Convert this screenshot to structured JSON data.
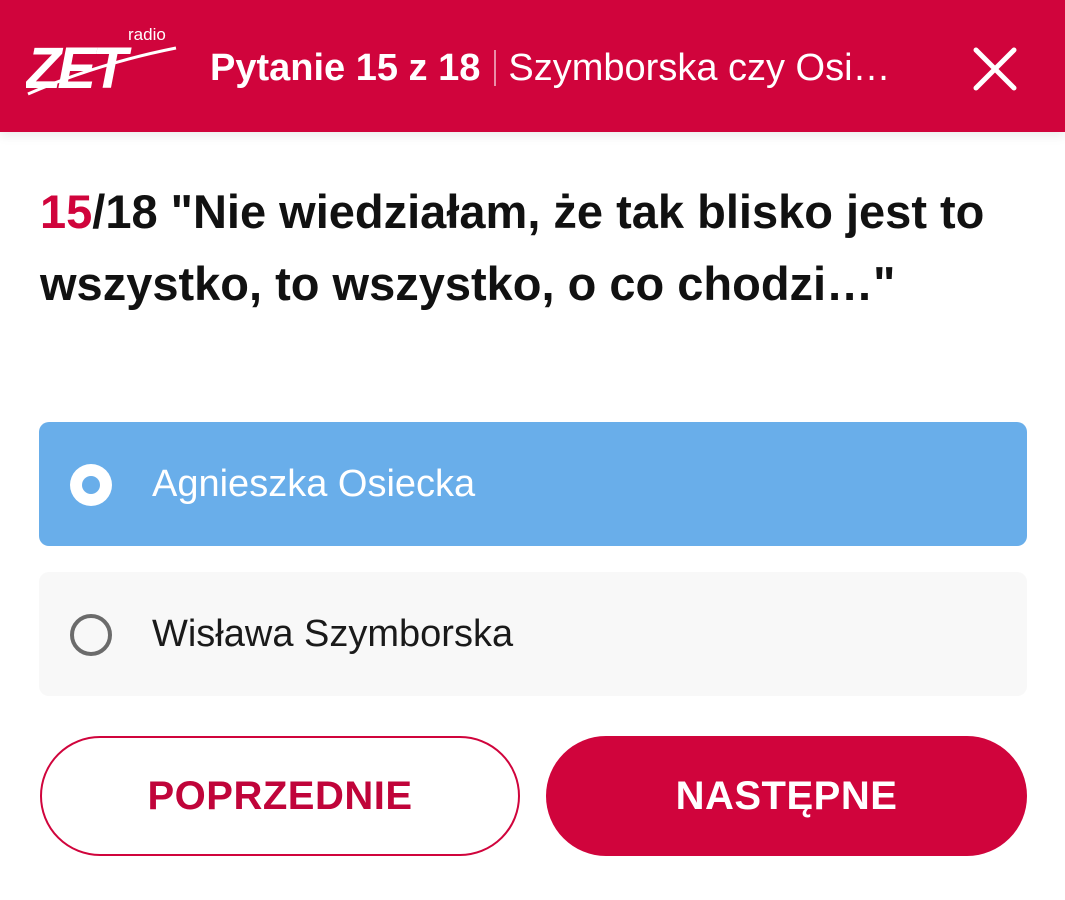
{
  "header": {
    "logo_text": "ZET",
    "logo_small": "radio",
    "question_counter": "Pytanie 15 z 18",
    "quiz_title": "Szymborska czy Osi…",
    "close_icon": "close-icon",
    "brand_color": "#d0043c"
  },
  "question": {
    "number": "15",
    "total": "/18",
    "text": " \"Nie wiedziałam, że tak blisko jest to wszystko, to wszystko, o co chodzi…\""
  },
  "options": [
    {
      "label": "Agnieszka Osiecka",
      "selected": true,
      "color": "#69aeea"
    },
    {
      "label": "Wisława Szymborska",
      "selected": false
    }
  ],
  "buttons": {
    "prev_label": "POPRZEDNIE",
    "next_label": "NASTĘPNE"
  }
}
